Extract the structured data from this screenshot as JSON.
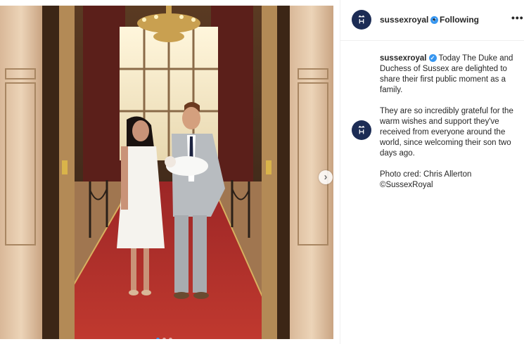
{
  "header": {
    "username": "sussexroyal",
    "separator": "•",
    "follow_status": "Following",
    "more_label": "•••",
    "verified_glyph": "✓"
  },
  "caption": {
    "username": "sussexroyal",
    "paragraph1": "Today The Duke and Duchess of Sussex are delighted to share their first public moment as a family.",
    "paragraph2": "They are so incredibly grateful for the warm wishes and support they've received from everyone around the world, since welcoming their son two days ago.",
    "paragraph3_line1": "Photo cred: Chris Allerton",
    "paragraph3_line2": "©SussexRoyal"
  },
  "carousel": {
    "next_glyph": "›",
    "slide_count": 3,
    "active_slide": 1
  },
  "icons": [
    "royal-monogram-icon",
    "verified-icon",
    "more-options-icon",
    "chevron-right-icon"
  ],
  "colors": {
    "avatar": "#1c2c55",
    "verified": "#3897f0",
    "carpet": "#b52a2a",
    "active_dot": "#3897f0"
  }
}
